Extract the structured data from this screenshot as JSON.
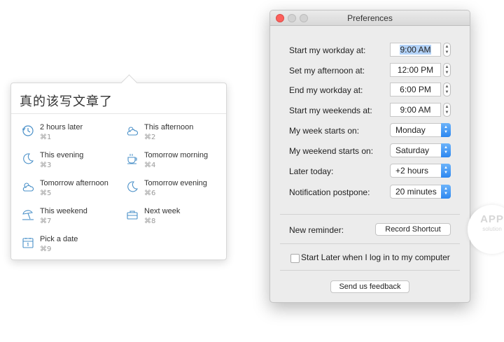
{
  "popover": {
    "title": "真的该写文章了",
    "options": [
      {
        "label": "2 hours later",
        "shortcut": "⌘1",
        "icon": "clock-icon"
      },
      {
        "label": "This afternoon",
        "shortcut": "⌘2",
        "icon": "cloud-sun-icon"
      },
      {
        "label": "This evening",
        "shortcut": "⌘3",
        "icon": "moon-icon"
      },
      {
        "label": "Tomorrow morning",
        "shortcut": "⌘4",
        "icon": "coffee-cup-icon"
      },
      {
        "label": "Tomorrow afternoon",
        "shortcut": "⌘5",
        "icon": "cloud-sun-icon"
      },
      {
        "label": "Tomorrow evening",
        "shortcut": "⌘6",
        "icon": "moon-icon"
      },
      {
        "label": "This weekend",
        "shortcut": "⌘7",
        "icon": "beach-umbrella-icon"
      },
      {
        "label": "Next week",
        "shortcut": "⌘8",
        "icon": "briefcase-icon"
      },
      {
        "label": "Pick a date",
        "shortcut": "⌘9",
        "icon": "calendar-icon"
      }
    ],
    "icon_color": "#4a90c8"
  },
  "prefs": {
    "title": "Preferences",
    "workday_start": {
      "label": "Start my workday at:",
      "value": "9:00 AM"
    },
    "afternoon": {
      "label": "Set my afternoon at:",
      "value": "12:00 PM"
    },
    "workday_end": {
      "label": "End my workday at:",
      "value": "6:00 PM"
    },
    "weekend_start": {
      "label": "Start my weekends at:",
      "value": "9:00 AM"
    },
    "week_starts": {
      "label": "My week starts on:",
      "value": "Monday"
    },
    "weekend_starts": {
      "label": "My weekend starts on:",
      "value": "Saturday"
    },
    "later_today": {
      "label": "Later today:",
      "value": "+2 hours"
    },
    "postpone": {
      "label": "Notification postpone:",
      "value": "20 minutes"
    },
    "new_reminder_label": "New reminder:",
    "record_shortcut": "Record Shortcut",
    "login_checkbox": "Start Later when I log in to my computer",
    "login_checked": false,
    "feedback": "Send us feedback",
    "accent": "#2c87f0",
    "close_color": "#fc605c"
  },
  "watermark": {
    "line1": "APP",
    "line2": "solution"
  }
}
